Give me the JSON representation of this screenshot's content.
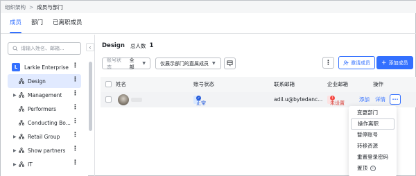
{
  "breadcrumb": {
    "parent": "组织架构",
    "separator": ">",
    "current": "成员与部门"
  },
  "tabs": [
    {
      "label": "成员",
      "active": true
    },
    {
      "label": "部门",
      "active": false
    },
    {
      "label": "已离职成员",
      "active": false
    }
  ],
  "sidebar": {
    "search_placeholder": "请输入姓名、邮箱...",
    "root": {
      "badge": "L",
      "label": "Larkie Enterprise"
    },
    "items": [
      {
        "label": "Design",
        "selected": true
      },
      {
        "label": "Management",
        "caret": true
      },
      {
        "label": "Performers"
      },
      {
        "label": "Conducting Bo..."
      },
      {
        "label": "Retail Group",
        "caret": true
      },
      {
        "label": "Show partners",
        "caret": true
      },
      {
        "label": "IT",
        "caret": true
      }
    ],
    "collapse_icon": "‹"
  },
  "main": {
    "dept_name": "Design",
    "total_label": "总人数",
    "total_count": "1",
    "filter_status": {
      "label": "账号状态",
      "value": "全部"
    },
    "filter_scope": {
      "value": "仅展示部门的直属成员"
    },
    "more_label": "⋮",
    "invite_label": "邀请成员",
    "add_label": "添加成员"
  },
  "table": {
    "headers": {
      "name": "姓名",
      "status": "账号状态",
      "email": "联系邮箱",
      "corp_email": "企业邮箱",
      "action": "操作"
    },
    "row": {
      "status": "正常",
      "email": "adil.u@bytedanc...",
      "corp_status": "未设置",
      "corp_add": "添加",
      "detail": "详情",
      "more": "···"
    }
  },
  "menu": {
    "items": [
      {
        "label": "变更部门"
      },
      {
        "label": "操作离职",
        "highlight": true
      },
      {
        "label": "暂停账号"
      },
      {
        "label": "转移资源"
      },
      {
        "label": "重置登录密码"
      },
      {
        "label": "置顶",
        "info": true
      }
    ]
  },
  "colors": {
    "accent": "#3370ff",
    "danger": "#f54a45",
    "selected_bg": "#e1eaff"
  }
}
